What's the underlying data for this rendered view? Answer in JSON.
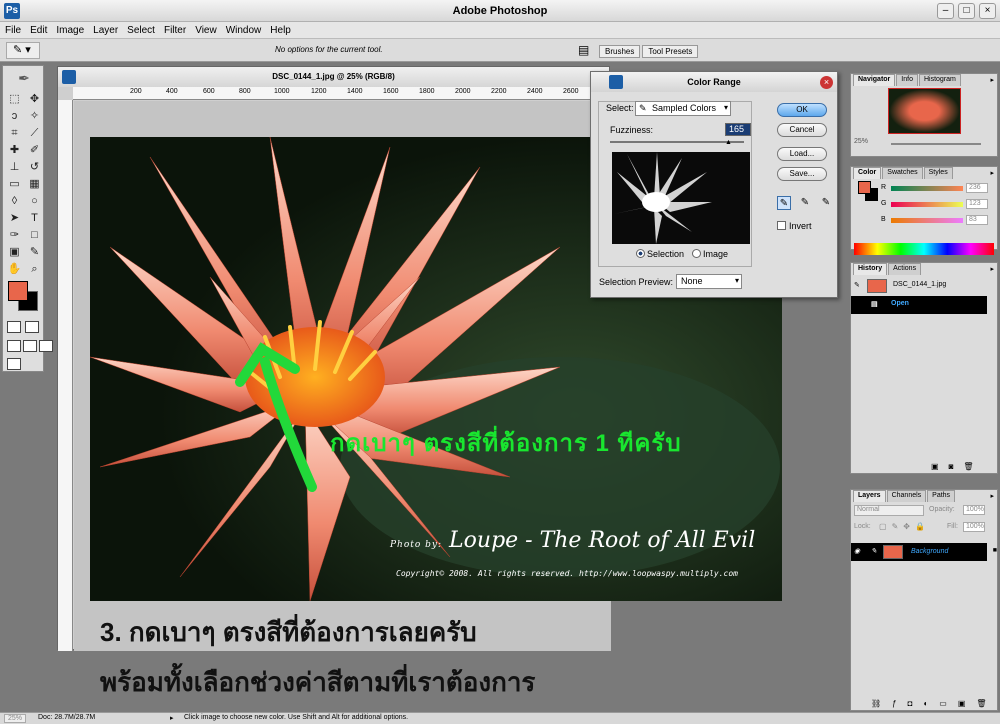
{
  "app": {
    "title": "Adobe Photoshop"
  },
  "menu": [
    "File",
    "Edit",
    "Image",
    "Layer",
    "Select",
    "Filter",
    "View",
    "Window",
    "Help"
  ],
  "options_bar": {
    "message": "No options for the current tool.",
    "palette_tabs": [
      "Brushes",
      "Tool Presets"
    ]
  },
  "document": {
    "title": "DSC_0144_1.jpg @ 25% (RGB/8)",
    "ruler_labels": [
      "200",
      "400",
      "600",
      "800",
      "1000",
      "1200",
      "1400",
      "1600",
      "1800",
      "2000",
      "2200",
      "2400",
      "2600"
    ]
  },
  "photo": {
    "watermark_by": "Photo by:",
    "watermark_name": "Loupe - The Root of All Evil",
    "copyright": "Copyright© 2008. All rights reserved. http://www.loopwaspy.multiply.com",
    "green_note": "กดเบาๆ ตรงสีที่ต้องการ 1 ทีครับ"
  },
  "captions": {
    "line1": "3. กดเบาๆ ตรงสีที่ต้องการเลยครับ",
    "line2": "พร้อมทั้งเลือกช่วงค่าสีตามที่เราต้องการ"
  },
  "color_range": {
    "title": "Color Range",
    "select_label": "Select:",
    "select_value": "Sampled Colors",
    "fuzziness_label": "Fuzziness:",
    "fuzziness_value": "165",
    "radio_selection": "Selection",
    "radio_image": "Image",
    "selection_preview_label": "Selection Preview:",
    "selection_preview_value": "None",
    "buttons": {
      "ok": "OK",
      "cancel": "Cancel",
      "load": "Load...",
      "save": "Save..."
    },
    "invert_label": "Invert"
  },
  "navigator_panel": {
    "tabs": [
      "Navigator",
      "Info",
      "Histogram"
    ],
    "zoom": "25%"
  },
  "color_panel": {
    "tabs": [
      "Color",
      "Swatches",
      "Styles"
    ],
    "channels": [
      {
        "label": "R",
        "value": "236"
      },
      {
        "label": "G",
        "value": "123"
      },
      {
        "label": "B",
        "value": "83"
      }
    ]
  },
  "history_panel": {
    "tabs": [
      "History",
      "Actions"
    ],
    "snapshot": "DSC_0144_1.jpg",
    "states": [
      "Open"
    ]
  },
  "layers_panel": {
    "tabs": [
      "Layers",
      "Channels",
      "Paths"
    ],
    "blend_mode": "Normal",
    "opacity_label": "Opacity:",
    "opacity_value": "100%",
    "lock_label": "Lock:",
    "fill_label": "Fill:",
    "fill_value": "100%",
    "layer_name": "Background"
  },
  "status_bar": {
    "zoom": "25%",
    "doc_size": "Doc: 28.7M/28.7M",
    "hint": "Click image to choose new color.  Use Shift and Alt for additional options."
  },
  "colors": {
    "foreground": "#e8664b",
    "background": "#000000",
    "selection_highlight": "#000000",
    "note_green": "#19e62f"
  }
}
